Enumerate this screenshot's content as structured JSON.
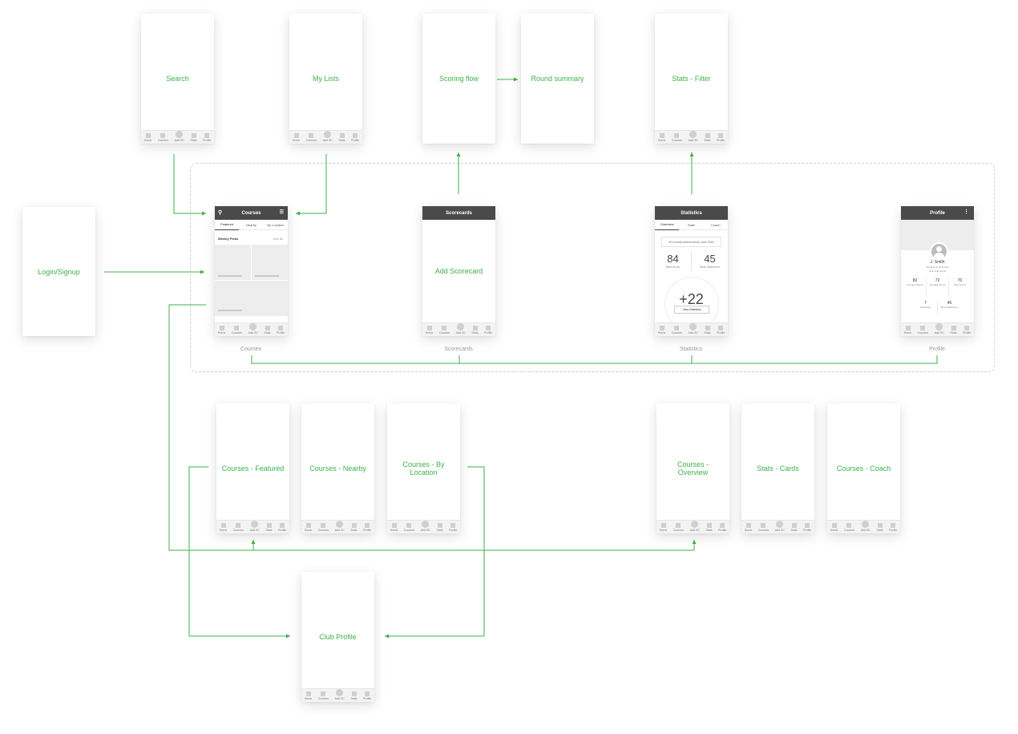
{
  "tabbar": {
    "home": "Home",
    "courses": "Courses",
    "add": "Add SC",
    "stats": "Stats",
    "profile": "Profile"
  },
  "screens": {
    "search": "Search",
    "my_lists": "My Lists",
    "scoring_flow": "Scoring flow",
    "round_summary": "Round summary",
    "stats_filter": "Stats - Filter",
    "login": "Login/Signup",
    "courses_featured": "Courses - Featured",
    "courses_nearby": "Courses - Nearby",
    "courses_by_location": "Courses - By Location",
    "courses_overview": "Courses - Overview",
    "stats_cards": "Stats - Cards",
    "courses_coach": "Courses - Coach",
    "club_profile": "Club Profile"
  },
  "courses_screen": {
    "header": "Courses",
    "tabs": [
      "Featured",
      "Nearby",
      "By Location"
    ],
    "section": "Weekly Picks",
    "section_link": "See all",
    "caption": "Courses"
  },
  "scorecards_screen": {
    "header": "Scorecards",
    "action": "Add Scorecard",
    "caption": "Scorecards"
  },
  "statistics_screen": {
    "header": "Statistics",
    "tabs": [
      "Overview",
      "Stats",
      "Coach"
    ],
    "notice": "40 rounds entered since June 2016",
    "best_score": "84",
    "best_score_label": "Best Score",
    "best_stableford": "45",
    "best_stableford_label": "Best Stableford",
    "handicap": "+22",
    "button": "View Statistics",
    "caption": "Statistics"
  },
  "profile_screen": {
    "header": "Profile",
    "more_icon": "more-vertical-icon",
    "name": "J. Smith",
    "club": "Member of Golf Club",
    "club_link": "Golf Club Name",
    "stats": [
      {
        "value": "82",
        "label": "Rounds Played"
      },
      {
        "value": "72",
        "label": "Average Score"
      },
      {
        "value": "70",
        "label": "Best Score"
      }
    ],
    "stats2": [
      {
        "value": "7",
        "label": "Handicap"
      },
      {
        "value": "45",
        "label": "Best Stableford"
      }
    ],
    "caption": "Profile"
  },
  "colors": {
    "accent": "#3cb24a",
    "header": "#4a4a4a",
    "dashed": "#cfcfcf"
  }
}
